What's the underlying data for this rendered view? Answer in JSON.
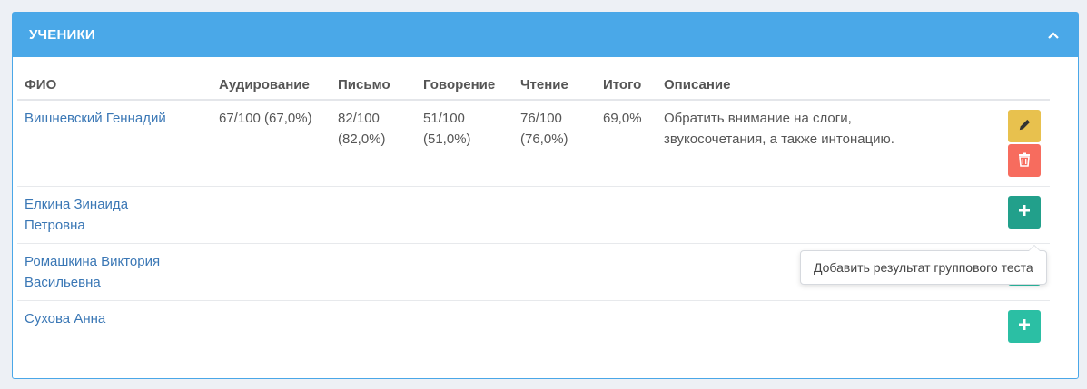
{
  "panel": {
    "title": "УЧЕНИКИ",
    "collapse_icon": "chevron-up-icon",
    "header_color": "#4aa8e8"
  },
  "table": {
    "headers": {
      "name": "ФИО",
      "listening": "Аудирование",
      "writing": "Письмо",
      "speaking": "Говорение",
      "reading": "Чтение",
      "total": "Итого",
      "description": "Описание"
    },
    "rows": [
      {
        "name": "Вишневский Геннадий",
        "listening": "67/100 (67,0%)",
        "writing_1": "82/100",
        "writing_2": "(82,0%)",
        "speaking_1": "51/100",
        "speaking_2": "(51,0%)",
        "reading_1": "76/100",
        "reading_2": "(76,0%)",
        "total": "69,0%",
        "description_1": "Обратить внимание на слоги,",
        "description_2": "звукосочетания, а также интонацию.",
        "actions": [
          "pencil-icon",
          "trash-icon"
        ]
      },
      {
        "name_1": "Елкина Зинаида",
        "name_2": "Петровна",
        "actions": [
          "plus-icon"
        ]
      },
      {
        "name_1": "Ромашкина Виктория",
        "name_2": "Васильевна",
        "actions": [
          "plus-icon"
        ]
      },
      {
        "name": "Сухова Анна",
        "actions": [
          "plus-icon"
        ]
      }
    ]
  },
  "tooltip": {
    "text": "Добавить результат группового теста"
  },
  "colors": {
    "edit": "#e8c14e",
    "delete": "#f76c5e",
    "add": "#2bbfa4",
    "link": "#3a77b5"
  }
}
